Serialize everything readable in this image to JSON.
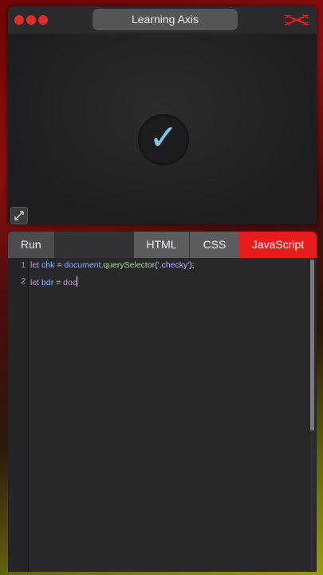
{
  "preview": {
    "title": "Learning Axis",
    "window_controls": [
      "close-dot",
      "minimize-dot",
      "maximize-dot"
    ],
    "logo_icon": "crossed-swords-logo-icon",
    "center_icon": "checkmark-icon",
    "checkmark_glyph": "✓",
    "expand_icon": "expand-arrows-icon"
  },
  "editor": {
    "tabs": {
      "run": "Run",
      "html": "HTML",
      "css": "CSS",
      "js": "JavaScript"
    },
    "active_tab": "JavaScript",
    "line_numbers": [
      "1",
      "2"
    ],
    "lines": [
      {
        "kw": "let",
        "var": " chk",
        "eq": " = ",
        "obj": "document",
        "dot": ".",
        "method": "querySelector",
        "open": "(",
        "str": "'.checky'",
        "close": ");"
      },
      {
        "kw": "let",
        "var": " bdr",
        "eq": " = ",
        "obj": "doc"
      }
    ]
  },
  "colors": {
    "accent_red": "#e81c1c",
    "check_blue": "#7ec8f0"
  }
}
